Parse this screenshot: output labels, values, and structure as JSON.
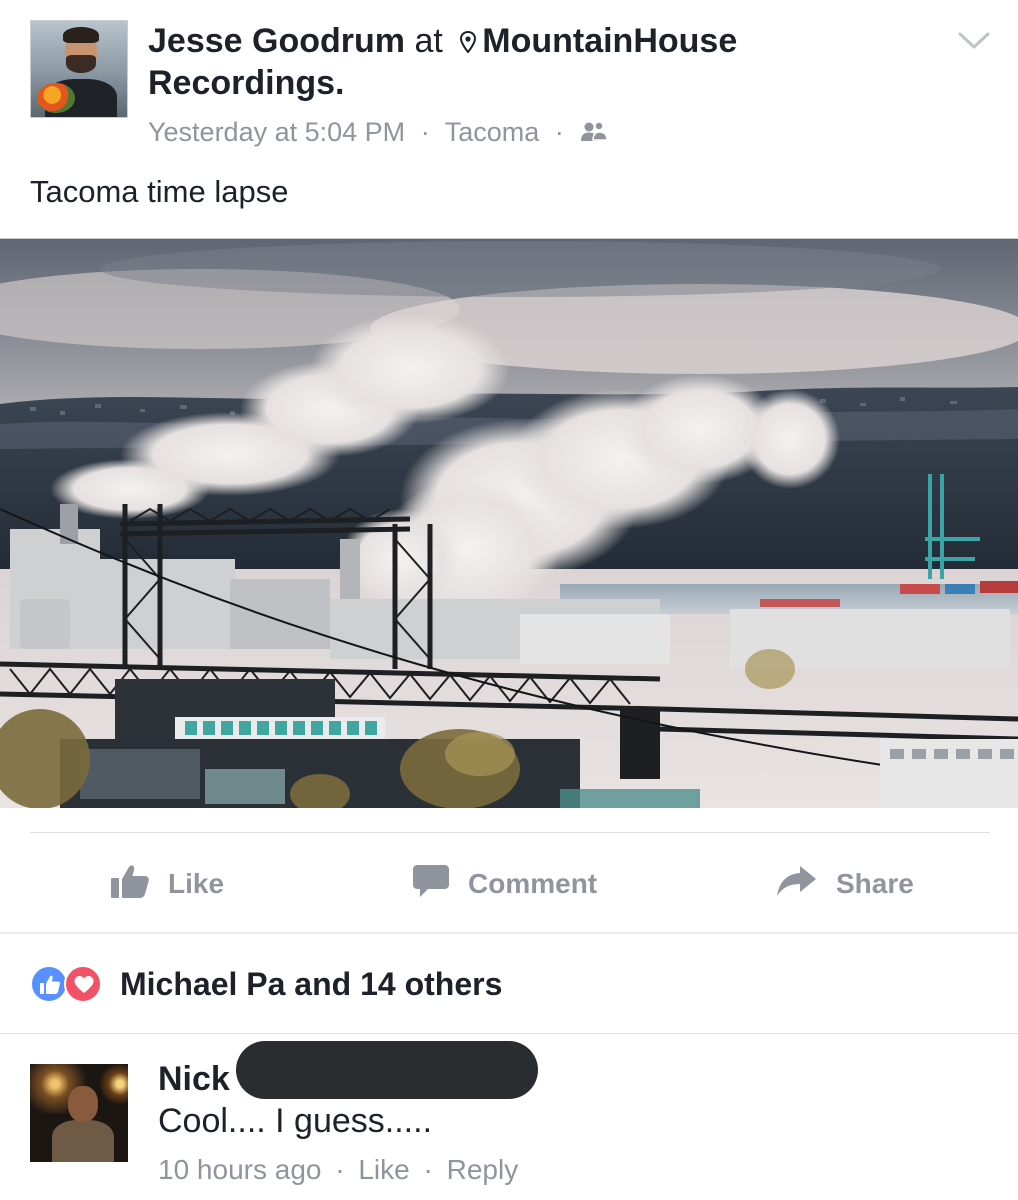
{
  "post": {
    "author": "Jesse Goodrum",
    "at_word": "at",
    "place": "MountainHouse Recordings.",
    "timestamp": "Yesterday at 5:04 PM",
    "location": "Tacoma",
    "audience_icon": "friends-icon",
    "text": "Tacoma time lapse",
    "media_alt": "Time lapse still of the Tacoma tideflats with industrial steam plumes and bridge"
  },
  "actions": {
    "like": "Like",
    "comment": "Comment",
    "share": "Share"
  },
  "reactions": {
    "summary": "Michael Pa and 14 others",
    "types": [
      "like",
      "love"
    ],
    "colors": {
      "like": "#5890ff",
      "love": "#f25268"
    }
  },
  "comment": {
    "author": "Nick",
    "text": "Cool.... I guess.....",
    "time": "10 hours ago",
    "like_label": "Like",
    "reply_label": "Reply"
  },
  "separator": "·",
  "colors": {
    "text_primary": "#1d2129",
    "text_secondary": "#90949c",
    "divider": "#dddfe2"
  }
}
